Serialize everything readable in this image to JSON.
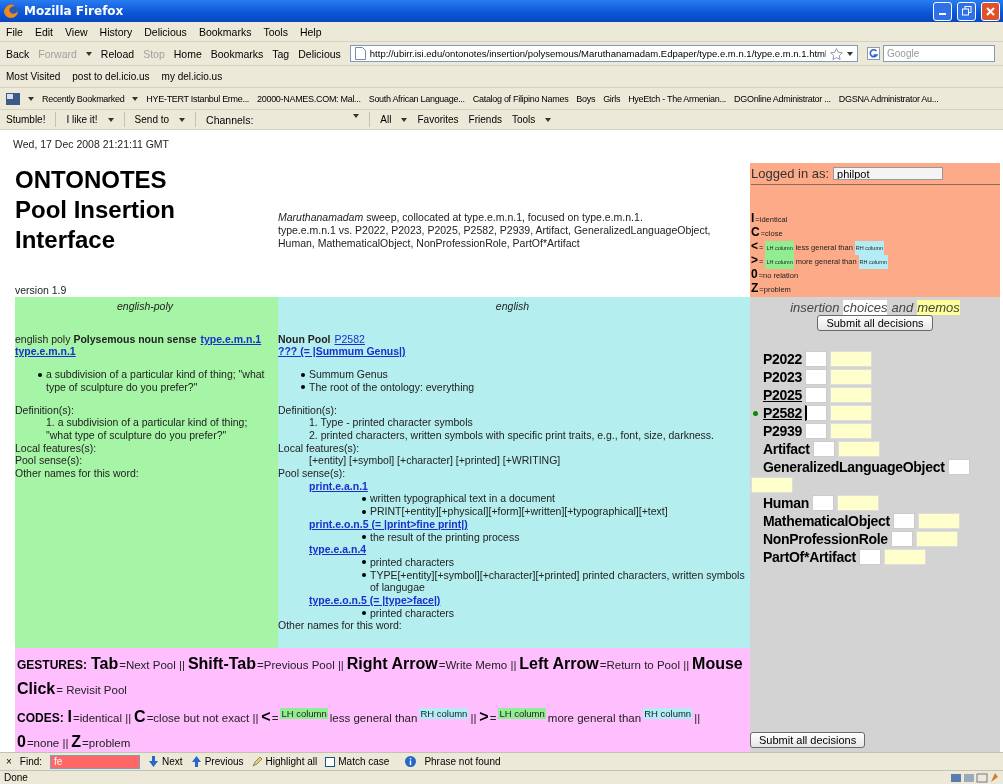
{
  "window": {
    "title": "Mozilla Firefox"
  },
  "menu": [
    "File",
    "Edit",
    "View",
    "History",
    "Delicious",
    "Bookmarks",
    "Tools",
    "Help"
  ],
  "nav_buttons": [
    {
      "label": "Back",
      "disabled": false,
      "dropdown": false
    },
    {
      "label": "Forward",
      "disabled": true,
      "dropdown": true
    },
    {
      "label": "Reload",
      "disabled": false,
      "dropdown": false
    },
    {
      "label": "Stop",
      "disabled": true,
      "dropdown": false
    },
    {
      "label": "Home",
      "disabled": false,
      "dropdown": false
    },
    {
      "label": "Bookmarks",
      "disabled": false,
      "dropdown": false
    },
    {
      "label": "Tag",
      "disabled": false,
      "dropdown": false
    },
    {
      "label": "Delicious",
      "disabled": false,
      "dropdown": false
    }
  ],
  "address": {
    "value": "http://ubirr.isi.edu/ontonotes/insertion/polysemous/Maruthanamadam.Edpaper/type.e.m.n.1/type.e.m.n.1.html"
  },
  "search": {
    "placeholder": "Google"
  },
  "bookmarks": [
    "Most Visited",
    "post to del.icio.us",
    "my del.icio.us"
  ],
  "bookmarks_2": [
    {
      "label": "Recently Bookmarked",
      "dropdown": true
    },
    {
      "label": "HYE-TERT Istanbul Erme...",
      "dropdown": false
    },
    {
      "label": "20000-NAMES.COM: Mal...",
      "dropdown": false
    },
    {
      "label": "South African Language...",
      "dropdown": false
    },
    {
      "label": "Catalog of Filipino Names",
      "dropdown": false
    },
    {
      "label": "Boys",
      "dropdown": false
    },
    {
      "label": "Girls",
      "dropdown": false
    },
    {
      "label": "HyeEtch - The Armenian...",
      "dropdown": false
    },
    {
      "label": "DGOnline Administrator ...",
      "dropdown": false
    },
    {
      "label": "DGSNA Administrator Au...",
      "dropdown": false
    }
  ],
  "stumble_toolbar": [
    {
      "label": "Stumble!",
      "kind": "button",
      "dropdown": false
    },
    {
      "label": "I like it!",
      "kind": "button",
      "dropdown": true
    },
    {
      "label": "Send to",
      "kind": "button",
      "dropdown": true
    },
    {
      "label": "Channels:",
      "kind": "combo",
      "dropdown": true
    },
    {
      "label": "All",
      "kind": "button",
      "dropdown": true
    },
    {
      "label": "Favorites",
      "kind": "button",
      "dropdown": false
    },
    {
      "label": "Friends",
      "kind": "button",
      "dropdown": false
    },
    {
      "label": "Tools",
      "kind": "button",
      "dropdown": true
    }
  ],
  "page": {
    "date": "Wed, 17 Dec 2008 21:21:11 GMT",
    "title": [
      "ONTONOTES",
      "Pool Insertion",
      "Interface"
    ],
    "version": "version 1.9",
    "description": [
      "*Maruthanamadam* sweep, collocated at type.e.m.n.1, focused on type.e.m.n.1.",
      "type.e.m.n.1 vs. P2022, P2023, P2025, P2582, P2939, Artifact, GeneralizedLanguageObject, Human, MathematicalObject, NonProfessionRole, PartOf*Artifact"
    ],
    "login": {
      "label": "Logged in as:",
      "value": "philpot"
    },
    "legend": [
      {
        "kind": "plain",
        "code": "I",
        "text": "=identical"
      },
      {
        "kind": "plain",
        "code": "C",
        "text": "=close"
      },
      {
        "kind": "compare",
        "code": "<",
        "eq": "=",
        "lh": "LH column",
        "text": "less general than",
        "rh": "RH column"
      },
      {
        "kind": "compare",
        "code": ">",
        "eq": "=",
        "lh": "LH column",
        "text": "more general than",
        "rh": "RH column"
      },
      {
        "kind": "plain",
        "code": "0",
        "text": "=no relation"
      },
      {
        "kind": "plain",
        "code": "Z",
        "text": "=problem"
      }
    ],
    "columns": [
      {
        "heading": "english-poly",
        "color": "#a6f5a6",
        "title_lines": [
          [
            {
              "kind": "text",
              "text": "english poly **Polysemous noun sense**"
            },
            {
              "kind": "link",
              "text": "type.e.m.n.1",
              "bold": true
            }
          ],
          [
            {
              "kind": "link",
              "text": "type.e.m.n.1",
              "bold": true
            }
          ]
        ],
        "bullets": [
          "a subdivision of a particular kind of thing; \"what type of sculpture do you prefer?\""
        ],
        "sections": [
          {
            "label": "Definition(s):",
            "kind": "list",
            "items": [
              "1. a subdivision of a particular kind of thing; \"what type of sculpture do you prefer?\""
            ]
          },
          {
            "label": "Local features(s):",
            "kind": "label"
          },
          {
            "label": "Pool sense(s):",
            "kind": "label"
          },
          {
            "label": "Other names for this word:",
            "kind": "label"
          }
        ]
      },
      {
        "heading": "english",
        "color": "#b5eeee",
        "title_lines": [
          [
            {
              "kind": "text",
              "text": "**Noun Pool**"
            },
            {
              "kind": "link",
              "text": "P2582",
              "bold": false
            }
          ],
          [
            {
              "kind": "link",
              "text": "??? (= |Summum Genus|)",
              "bold": true
            }
          ]
        ],
        "bullets": [
          "Summum Genus",
          "The root of the ontology: everything"
        ],
        "sections": [
          {
            "label": "Definition(s):",
            "kind": "list",
            "items": [
              "1. Type - printed character symbols",
              "2. printed characters, written symbols with specific print traits, e.g., font, size, darkness."
            ]
          },
          {
            "label": "Local features(s):",
            "kind": "list",
            "items": [
              "[+entity] [+symbol] [+character] [+printed] [+WRITING]"
            ]
          },
          {
            "label": "Pool sense(s):",
            "kind": "senses",
            "senses": [
              {
                "link": "print.e.a.n.1",
                "bullets": [
                  "written typographical text in a document",
                  "PRINT[+entity][+physical][+form][+written][+typographical][+text]"
                ]
              },
              {
                "link": "print.e.o.n.5 (= |print>fine print|)",
                "bullets": [
                  "the result of the printing process"
                ]
              },
              {
                "link": "type.e.a.n.4",
                "bullets": [
                  "printed characters",
                  "TYPE[+entity][+symbol][+character][+printed] printed characters, written symbols of langugae"
                ]
              },
              {
                "link": "type.e.o.n.5 (= |type>face|)",
                "bullets": [
                  "printed characters"
                ]
              }
            ]
          },
          {
            "label": "Other names for this word:",
            "kind": "label"
          }
        ]
      }
    ],
    "choices": {
      "heading": [
        {
          "text": "insertion",
          "kind": "plain"
        },
        {
          "text": "choices",
          "kind": "choice"
        },
        {
          "text": "and",
          "kind": "plain"
        },
        {
          "text": "memos",
          "kind": "memo"
        }
      ],
      "submit_top": "Submit all decisions",
      "rows": [
        {
          "label": "P2022",
          "underlined": false,
          "current": false
        },
        {
          "label": "P2023",
          "underlined": false,
          "current": false
        },
        {
          "label": "P2025",
          "underlined": true,
          "current": false
        },
        {
          "label": "P2582",
          "underlined": true,
          "current": true
        },
        {
          "label": "P2939",
          "underlined": false,
          "current": false
        },
        {
          "label": "Artifact",
          "underlined": false,
          "current": false
        },
        {
          "label": "GeneralizedLanguageObject",
          "underlined": false,
          "current": false
        },
        {
          "label": "Human",
          "underlined": false,
          "current": false
        },
        {
          "label": "MathematicalObject",
          "underlined": false,
          "current": false
        },
        {
          "label": "NonProfessionRole",
          "underlined": false,
          "current": false
        },
        {
          "label": "PartOf*Artifact",
          "underlined": false,
          "current": false
        }
      ],
      "submit_bottom": "Submit all decisions"
    },
    "gestures": {
      "label": "GESTURES:",
      "items": [
        {
          "key": "Tab",
          "text": "=Next Pool ||"
        },
        {
          "key": "Shift-Tab",
          "text": "=Previous Pool ||"
        },
        {
          "key": "Right Arrow",
          "text": "=Write Memo ||"
        },
        {
          "key": "Left Arrow",
          "text": "=Return to Pool ||"
        },
        {
          "key": "Mouse Click",
          "text": "= Revisit Pool"
        }
      ]
    },
    "codes": {
      "label": "CODES:",
      "items": [
        {
          "kind": "plain",
          "code": "I",
          "text": "=identical ||"
        },
        {
          "kind": "plain",
          "code": "C",
          "text": "=close but not exact ||"
        },
        {
          "kind": "compare",
          "code": "<",
          "eq": "=",
          "lh": "LH column",
          "text": "less general than",
          "rh": "RH column",
          "sep": "||"
        },
        {
          "kind": "compare",
          "code": ">",
          "eq": "=",
          "lh": "LH column",
          "text": "more general than",
          "rh": "RH column",
          "sep": "||"
        },
        {
          "kind": "plain",
          "code": "0",
          "text": "=none ||"
        },
        {
          "kind": "plain",
          "code": "Z",
          "text": "=problem"
        }
      ]
    }
  },
  "find_bar": {
    "close": "×",
    "label": "Find:",
    "value": "fe",
    "not_found": true,
    "next": "Next",
    "previous": "Previous",
    "highlight": "Highlight all",
    "match_case": {
      "label": "Match case",
      "checked": false
    },
    "message": "Phrase not found"
  },
  "status_bar": {
    "text": "Done"
  }
}
